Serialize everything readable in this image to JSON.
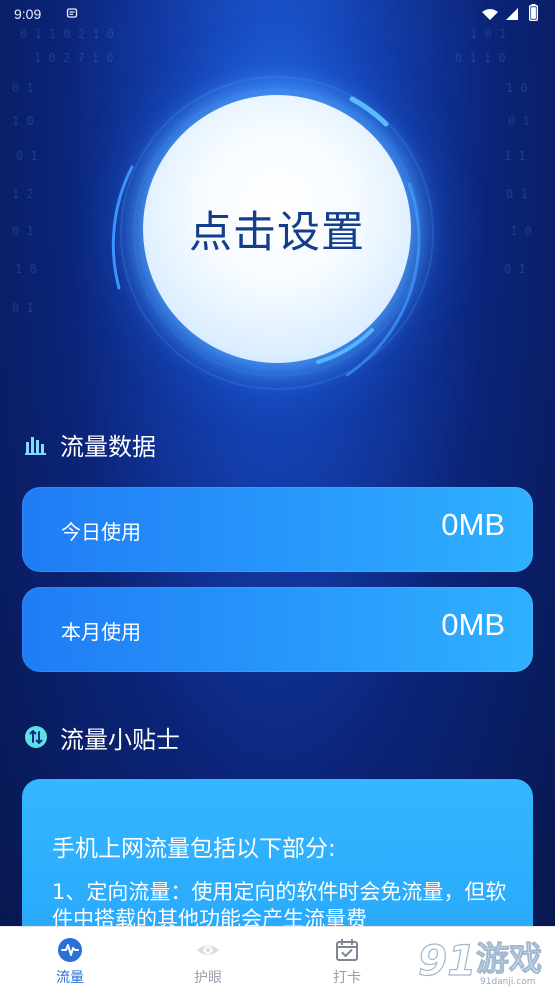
{
  "status_bar": {
    "time": "9:09"
  },
  "main_button": {
    "label": "点击设置"
  },
  "traffic_section": {
    "title": "流量数据",
    "cards": [
      {
        "label": "今日使用",
        "value": "0MB"
      },
      {
        "label": "本月使用",
        "value": "0MB"
      }
    ]
  },
  "tips_section": {
    "title": "流量小贴士",
    "card_title": "手机上网流量包括以下部分:",
    "card_body": "1、定向流量：使用定向的软件时会免流量，但软件中搭载的其他功能会产生流量费"
  },
  "bottom_nav": {
    "items": [
      {
        "label": "流量",
        "icon": "pulse-icon",
        "active": true
      },
      {
        "label": "护眼",
        "icon": "eye-icon",
        "active": false
      },
      {
        "label": "打卡",
        "icon": "calendar-check-icon",
        "active": false
      }
    ]
  },
  "colors": {
    "background": "#0b2478",
    "accent": "#2b6fd8",
    "card": "#2fb0ff",
    "main_button_text": "#143d8e"
  }
}
